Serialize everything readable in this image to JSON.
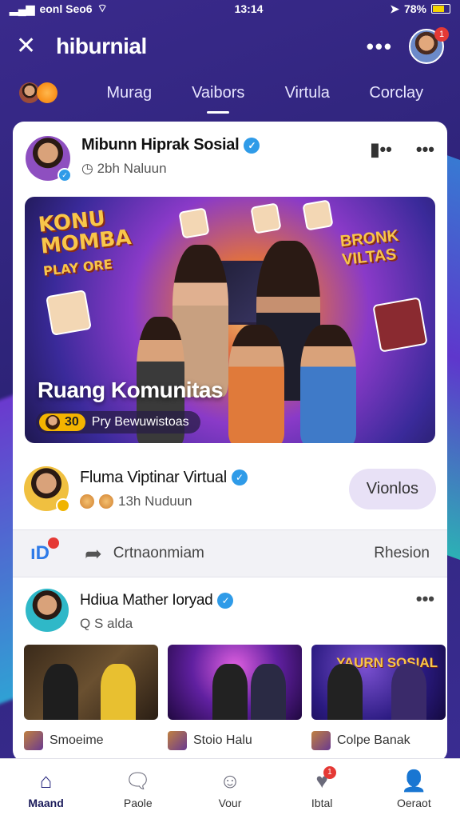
{
  "status_bar": {
    "carrier": "eonl Seo6",
    "time": "13:14",
    "battery": "78%"
  },
  "header": {
    "app_title": "hiburnial",
    "notification_count": "1"
  },
  "tabs": [
    {
      "label": "Murag"
    },
    {
      "label": "Vaibors"
    },
    {
      "label": "Virtula"
    },
    {
      "label": "Corclay"
    }
  ],
  "post1": {
    "title": "Mibunn Hiprak Sosial",
    "subtitle": "2bh Naluun",
    "banner": {
      "logo_left": "KONU MOMBA PLAY ORE",
      "logo_right": "BRONK VILTAS",
      "title": "Ruang Komunitas",
      "chip_count": "30",
      "chip_text": "Pry Bewuwistoas"
    }
  },
  "post2": {
    "title": "Fluma Viptinar Virtual",
    "subtitle": "13h Nuduun",
    "button_label": "Vionlos"
  },
  "action_bar": {
    "share_label": "Crtnaonmiam",
    "right_label": "Rhesion"
  },
  "post3": {
    "title": "Hdiua Mather Ioryad",
    "subtitle": "Q S alda",
    "thumbs": [
      {
        "label": "Smoeime"
      },
      {
        "label": "Stoio Halu"
      },
      {
        "label": "Colpe Banak",
        "overlay": "YAURN SOSIAL"
      }
    ]
  },
  "bottom_nav": [
    {
      "label": "Maand",
      "icon": "home-icon"
    },
    {
      "label": "Paole",
      "icon": "chat-icon"
    },
    {
      "label": "Vour",
      "icon": "face-icon"
    },
    {
      "label": "Ibtal",
      "icon": "heart-icon",
      "badge": "1"
    },
    {
      "label": "Oeraot",
      "icon": "profile-icon"
    }
  ]
}
